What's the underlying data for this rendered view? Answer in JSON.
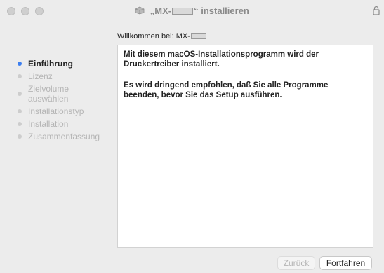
{
  "window": {
    "title_prefix": "„MX-",
    "title_suffix": "“ installieren"
  },
  "welcome": {
    "prefix": "Willkommen bei: MX-"
  },
  "steps": [
    {
      "label": "Einführung",
      "active": true
    },
    {
      "label": "Lizenz",
      "active": false
    },
    {
      "label": "Zielvolume",
      "label2": "auswählen",
      "active": false
    },
    {
      "label": "Installationstyp",
      "active": false
    },
    {
      "label": "Installation",
      "active": false
    },
    {
      "label": "Zusammenfassung",
      "active": false
    }
  ],
  "content": {
    "p1_line1": "Mit diesem macOS-Installationsprogramm wird der",
    "p1_line2": "Druckertreiber installiert.",
    "p2_line1": "Es wird dringend empfohlen, daß Sie alle Programme",
    "p2_line2": "beenden, bevor Sie das Setup ausführen."
  },
  "buttons": {
    "back": "Zurück",
    "continue": "Fortfahren"
  },
  "colors": {
    "active_dot": "#3d7ff0",
    "inactive_text": "#b5b5b5"
  }
}
